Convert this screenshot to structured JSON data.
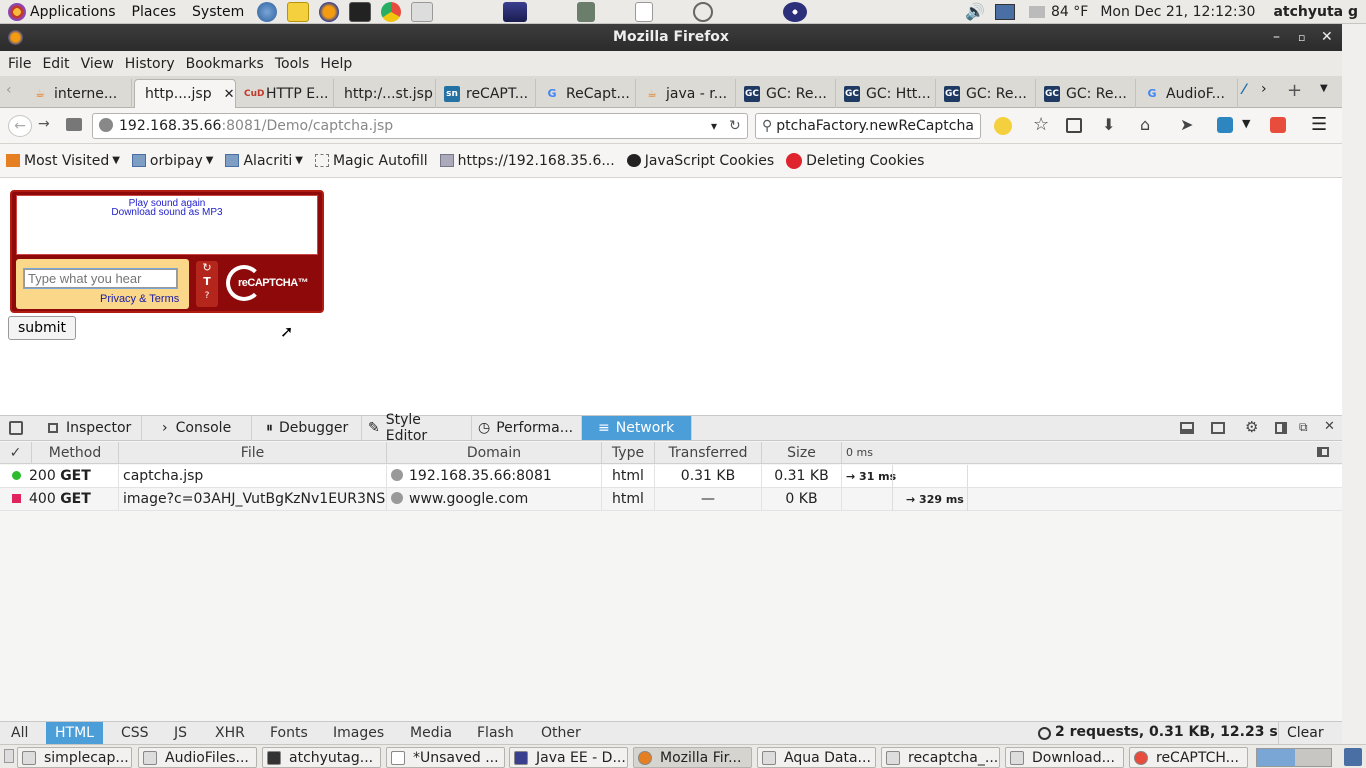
{
  "panel": {
    "applications": "Applications",
    "places": "Places",
    "system": "System",
    "weather": "84 °F",
    "clock": "Mon Dec 21, 12:12:30",
    "user": "atchyuta g"
  },
  "window": {
    "title": "Mozilla Firefox"
  },
  "menubar": [
    "File",
    "Edit",
    "View",
    "History",
    "Bookmarks",
    "Tools",
    "Help"
  ],
  "tabs": [
    {
      "label": "interne...",
      "icon": "java"
    },
    {
      "label": "http....jsp",
      "icon": "none",
      "active": true
    },
    {
      "label": "HTTP E...",
      "icon": "cud"
    },
    {
      "label": "http:/...st.jsp",
      "icon": "none"
    },
    {
      "label": "reCAPT...",
      "icon": "sn"
    },
    {
      "label": "ReCapt...",
      "icon": "google"
    },
    {
      "label": "java - r...",
      "icon": "java"
    },
    {
      "label": "GC: Re...",
      "icon": "gc"
    },
    {
      "label": "GC: Htt...",
      "icon": "gc"
    },
    {
      "label": "GC: Re...",
      "icon": "gc"
    },
    {
      "label": "GC: Re...",
      "icon": "gc"
    },
    {
      "label": "AudioF...",
      "icon": "google"
    }
  ],
  "nav": {
    "url_host": "192.168.35.66",
    "url_rest": ":8081/Demo/captcha.jsp",
    "search": "ptchaFactory.newReCaptcha"
  },
  "bookmarks": [
    "Most Visited",
    "orbipay",
    "Alacriti",
    "Magic Autofill",
    "https://192.168.35.6...",
    "JavaScript Cookies",
    "Deleting Cookies"
  ],
  "captcha": {
    "play_again": "Play sound again",
    "download_mp3": "Download sound as MP3",
    "placeholder": "Type what you hear",
    "privacy": "Privacy & Terms",
    "logo": "reCAPTCHA™",
    "submit": "submit"
  },
  "devtools": {
    "tabs": [
      "Inspector",
      "Console",
      "Debugger",
      "Style Editor",
      "Performa...",
      "Network"
    ],
    "columns": {
      "check": "✓",
      "method": "Method",
      "file": "File",
      "domain": "Domain",
      "type": "Type",
      "transferred": "Transferred",
      "size": "Size",
      "timeline": "0 ms"
    },
    "rows": [
      {
        "status": "200",
        "method": "GET",
        "file": "captcha.jsp",
        "domain": "192.168.35.66:8081",
        "type": "html",
        "transferred": "0.31 KB",
        "size": "0.31 KB",
        "timing": "→ 31 ms",
        "status_color": "#2cbb2c"
      },
      {
        "status": "400",
        "method": "GET",
        "file": "image?c=03AHJ_VutBgKzNv1EUR3NS...",
        "domain": "www.google.com",
        "type": "html",
        "transferred": "—",
        "size": "0 KB",
        "timing": "→ 329 ms",
        "status_color": "#e0245e"
      }
    ],
    "filters": [
      "All",
      "HTML",
      "CSS",
      "JS",
      "XHR",
      "Fonts",
      "Images",
      "Media",
      "Flash",
      "Other"
    ],
    "summary": "2 requests, 0.31 KB, 12.23 s",
    "clear": "Clear"
  },
  "taskbar": [
    "simplecap...",
    "AudioFiles...",
    "atchyutag...",
    "*Unsaved ...",
    "Java EE - D...",
    "Mozilla Fir...",
    "Aqua Data...",
    "recaptcha_...",
    "Download...",
    "reCAPTCH..."
  ]
}
